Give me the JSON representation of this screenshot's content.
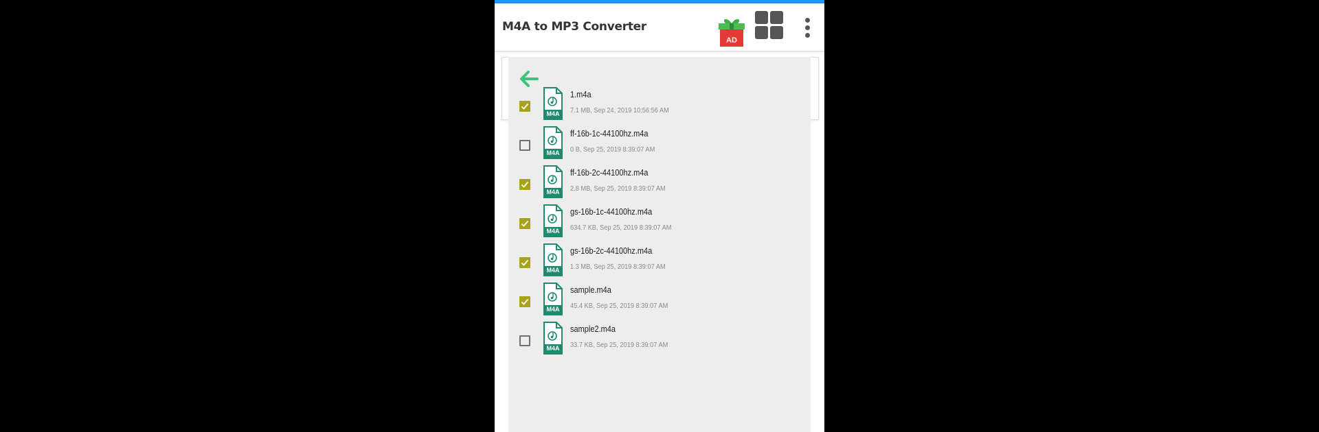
{
  "app": {
    "title": "M4A to MP3 Converter",
    "ad_label": "AD",
    "accent": "#2196f3",
    "back_arrow_color": "#3cc47c",
    "check_color": "#a8a31c",
    "file_icon_color": "#1e8a6e"
  },
  "toolbar": {
    "icons": [
      "gift-ad-icon",
      "grid-apps-icon",
      "more-vert-icon"
    ]
  },
  "file_list": {
    "items": [
      {
        "name": "1.m4a",
        "meta": "7.1 MB, Sep 24, 2019 10:56:56 AM",
        "checked": true,
        "badge": "M4A"
      },
      {
        "name": "ff-16b-1c-44100hz.m4a",
        "meta": "0 B, Sep 25, 2019 8:39:07 AM",
        "checked": false,
        "badge": "M4A"
      },
      {
        "name": "ff-16b-2c-44100hz.m4a",
        "meta": "2.8 MB, Sep 25, 2019 8:39:07 AM",
        "checked": true,
        "badge": "M4A"
      },
      {
        "name": "gs-16b-1c-44100hz.m4a",
        "meta": "634.7 KB, Sep 25, 2019 8:39:07 AM",
        "checked": true,
        "badge": "M4A"
      },
      {
        "name": "gs-16b-2c-44100hz.m4a",
        "meta": "1.3 MB, Sep 25, 2019 8:39:07 AM",
        "checked": true,
        "badge": "M4A"
      },
      {
        "name": "sample.m4a",
        "meta": "45.4 KB, Sep 25, 2019 8:39:07 AM",
        "checked": true,
        "badge": "M4A"
      },
      {
        "name": "sample2.m4a",
        "meta": "33.7 KB, Sep 25, 2019 8:39:07 AM",
        "checked": false,
        "badge": "M4A"
      }
    ]
  }
}
